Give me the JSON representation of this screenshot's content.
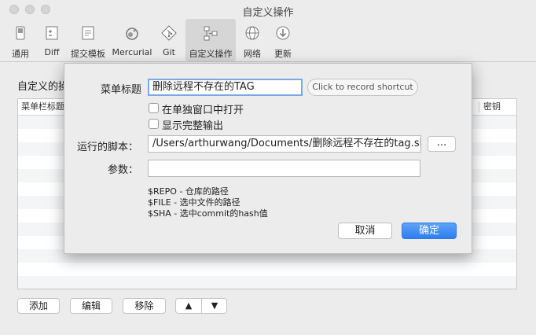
{
  "window": {
    "title": "自定义操作"
  },
  "toolbar": {
    "items": [
      {
        "label": "通用",
        "icon": "switch-icon"
      },
      {
        "label": "Diff",
        "icon": "diff-icon"
      },
      {
        "label": "提交模板",
        "icon": "commit-template-icon"
      },
      {
        "label": "Mercurial",
        "icon": "mercurial-icon"
      },
      {
        "label": "Git",
        "icon": "git-icon"
      },
      {
        "label": "自定义操作",
        "icon": "custom-actions-icon",
        "active": true
      },
      {
        "label": "网络",
        "icon": "network-icon"
      },
      {
        "label": "更新",
        "icon": "update-icon"
      }
    ]
  },
  "panel": {
    "title": "自定义的操作",
    "columns": {
      "menu_title": "菜单栏标题",
      "shortcut": "密钥"
    },
    "buttons": {
      "add": "添加",
      "edit": "编辑",
      "remove": "移除",
      "up": "▲",
      "down": "▼"
    }
  },
  "sheet": {
    "menu_title_label": "菜单标题",
    "menu_title_value": "删除远程不存在的TAG",
    "shortcut_button": "Click to record shortcut",
    "checkbox_separate_window": "在单独窗口中打开",
    "checkbox_full_output": "显示完整输出",
    "script_label": "运行的脚本：",
    "script_value": "/Users/arthurwang/Documents/删除远程不存在的tag.sh",
    "browse_button": "...",
    "params_label": "参数：",
    "params_value": "",
    "hints": [
      "$REPO - 仓库的路径",
      "$FILE - 选中文件的路径",
      "$SHA - 选中commit的hash值"
    ],
    "cancel_button": "取消",
    "ok_button": "确定"
  },
  "colors": {
    "accent": "#2d7ef0",
    "focus_ring": "#7aa7e6"
  }
}
